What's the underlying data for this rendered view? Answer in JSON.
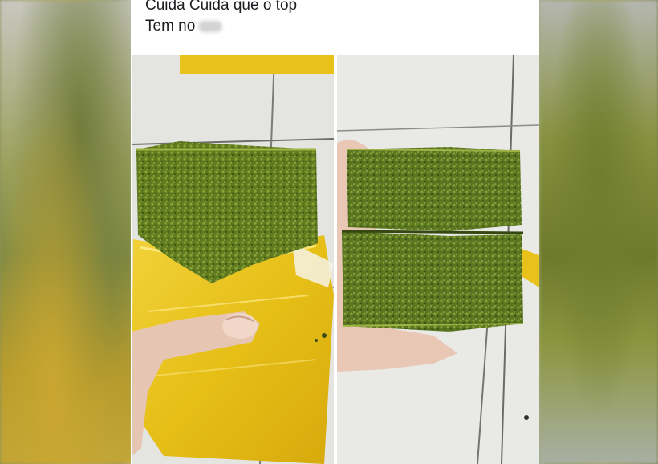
{
  "post": {
    "caption_line1": "Cuida Cuida que o top",
    "caption_line2": "Tem no"
  },
  "images": [
    {
      "name": "left-photo",
      "icon": "brick-in-yellow-wrap-photo"
    },
    {
      "name": "right-photo",
      "icon": "split-brick-in-hand-photo"
    }
  ],
  "colors": {
    "wrap_yellow": "#e8c21a",
    "compressed_green": "#5f7a1f",
    "skin": "#e6c6b2"
  }
}
